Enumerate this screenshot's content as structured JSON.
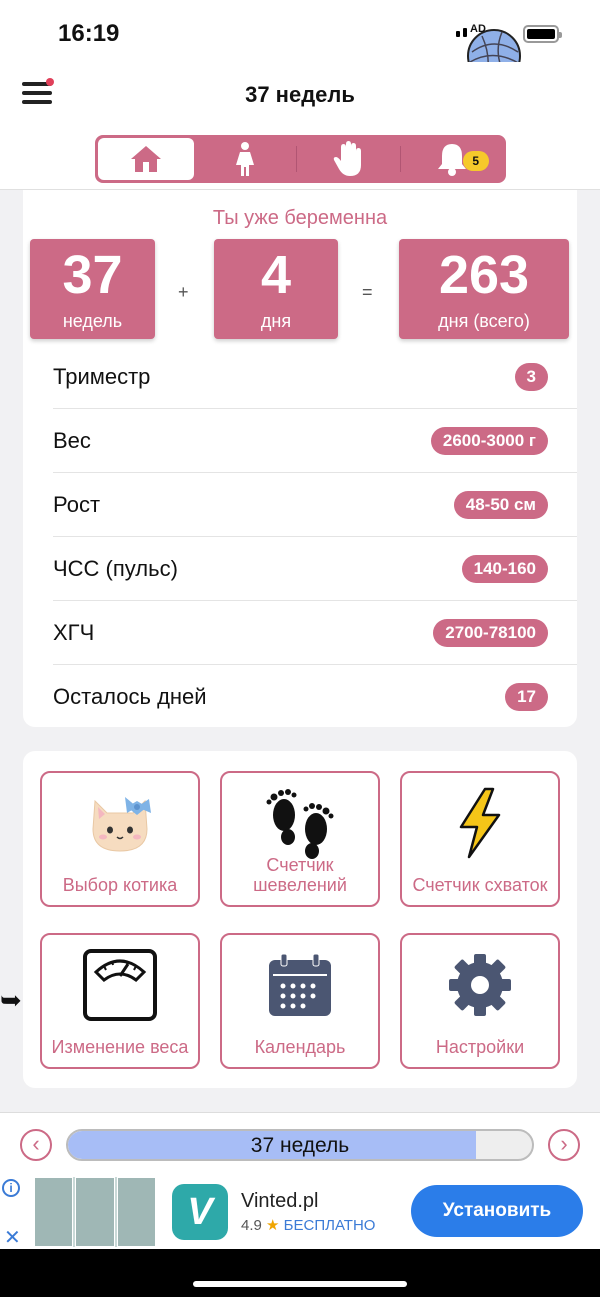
{
  "status": {
    "time": "16:19"
  },
  "header": {
    "title": "37 недель",
    "tabs": [
      {
        "name": "home",
        "icon": "home-icon"
      },
      {
        "name": "mother",
        "icon": "woman-icon"
      },
      {
        "name": "hand",
        "icon": "hand-icon"
      },
      {
        "name": "notifications",
        "icon": "bell-icon",
        "badge": "5"
      }
    ]
  },
  "summary": {
    "subtitle": "Ты уже беременна",
    "weeks": {
      "value": "37",
      "unit": "недель"
    },
    "plus": "+",
    "days": {
      "value": "4",
      "unit": "дня"
    },
    "equals": "=",
    "total": {
      "value": "263",
      "unit": "дня (всего)"
    }
  },
  "stats": [
    {
      "label": "Триместр",
      "value": "3"
    },
    {
      "label": "Вес",
      "value": "2600-3000 г"
    },
    {
      "label": "Рост",
      "value": "48-50 см"
    },
    {
      "label": "ЧСС (пульс)",
      "value": "140-160"
    },
    {
      "label": "ХГЧ",
      "value": "2700-78100"
    },
    {
      "label": "Осталось дней",
      "value": "17"
    }
  ],
  "actions": [
    {
      "label": "Выбор котика",
      "icon": "cat-icon"
    },
    {
      "label": "Счетчик шевелений",
      "icon": "footprints-icon"
    },
    {
      "label": "Счетчик схваток",
      "icon": "lightning-icon"
    },
    {
      "label": "Изменение веса",
      "icon": "scale-icon"
    },
    {
      "label": "Календарь",
      "icon": "calendar-icon"
    },
    {
      "label": "Настройки",
      "icon": "gear-icon"
    }
  ],
  "progress": {
    "label": "37 недель",
    "fraction": 0.88
  },
  "ad": {
    "name": "Vinted.pl",
    "rating": "4.9",
    "price": "БЕСПЛАТНО",
    "install": "Установить",
    "logo_letter": "V"
  },
  "colors": {
    "accent": "#cc6a86",
    "progress": "#a7bdf6",
    "ad_button": "#2b7de9"
  }
}
